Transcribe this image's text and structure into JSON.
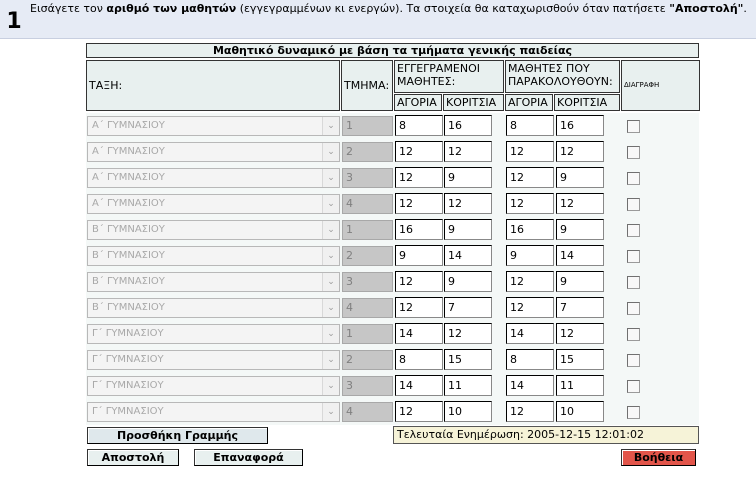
{
  "instruction": {
    "step_number": "1",
    "text_prefix": "Εισάγετε τον ",
    "text_bold1": "αριθμό των μαθητών",
    "text_middle": " (εγγεγραμμένων κι ενεργών). Τα στοιχεία θα καταχωρισθούν όταν πατήσετε ",
    "text_bold2": "\"Αποστολή\"",
    "text_suffix": "."
  },
  "table": {
    "title": "Μαθητικό δυναμικό με βάση τα τμήματα γενικής παιδείας",
    "headers": {
      "class": "ΤΑΞΗ:",
      "section": "ΤΜΗΜΑ:",
      "enrolled": "ΕΓΓΕΓΡΑΜΕΝΟΙ ΜΑΘΗΤΕΣ:",
      "attending": "ΜΑΘΗΤΕΣ ΠΟΥ ΠΑΡΑΚΟΛΟΥΘΟΥΝ:",
      "delete": "ΔΙΑΓΡΑΦΗ",
      "boys": "ΑΓΟΡΙΑ",
      "girls": "ΚΟΡΙΤΣΙΑ"
    },
    "rows": [
      {
        "class": "Α΄ ΓΥΜΝΑΣΙΟΥ",
        "section": "1",
        "enrolled_boys": "8",
        "enrolled_girls": "16",
        "attending_boys": "8",
        "attending_girls": "16"
      },
      {
        "class": "Α΄ ΓΥΜΝΑΣΙΟΥ",
        "section": "2",
        "enrolled_boys": "12",
        "enrolled_girls": "12",
        "attending_boys": "12",
        "attending_girls": "12"
      },
      {
        "class": "Α΄ ΓΥΜΝΑΣΙΟΥ",
        "section": "3",
        "enrolled_boys": "12",
        "enrolled_girls": "9",
        "attending_boys": "12",
        "attending_girls": "9"
      },
      {
        "class": "Α΄ ΓΥΜΝΑΣΙΟΥ",
        "section": "4",
        "enrolled_boys": "12",
        "enrolled_girls": "12",
        "attending_boys": "12",
        "attending_girls": "12"
      },
      {
        "class": "Β΄ ΓΥΜΝΑΣΙΟΥ",
        "section": "1",
        "enrolled_boys": "16",
        "enrolled_girls": "9",
        "attending_boys": "16",
        "attending_girls": "9"
      },
      {
        "class": "Β΄ ΓΥΜΝΑΣΙΟΥ",
        "section": "2",
        "enrolled_boys": "9",
        "enrolled_girls": "14",
        "attending_boys": "9",
        "attending_girls": "14"
      },
      {
        "class": "Β΄ ΓΥΜΝΑΣΙΟΥ",
        "section": "3",
        "enrolled_boys": "12",
        "enrolled_girls": "9",
        "attending_boys": "12",
        "attending_girls": "9"
      },
      {
        "class": "Β΄ ΓΥΜΝΑΣΙΟΥ",
        "section": "4",
        "enrolled_boys": "12",
        "enrolled_girls": "7",
        "attending_boys": "12",
        "attending_girls": "7"
      },
      {
        "class": "Γ΄ ΓΥΜΝΑΣΙΟΥ",
        "section": "1",
        "enrolled_boys": "14",
        "enrolled_girls": "12",
        "attending_boys": "14",
        "attending_girls": "12"
      },
      {
        "class": "Γ΄ ΓΥΜΝΑΣΙΟΥ",
        "section": "2",
        "enrolled_boys": "8",
        "enrolled_girls": "15",
        "attending_boys": "8",
        "attending_girls": "15"
      },
      {
        "class": "Γ΄ ΓΥΜΝΑΣΙΟΥ",
        "section": "3",
        "enrolled_boys": "14",
        "enrolled_girls": "11",
        "attending_boys": "14",
        "attending_girls": "11"
      },
      {
        "class": "Γ΄ ΓΥΜΝΑΣΙΟΥ",
        "section": "4",
        "enrolled_boys": "12",
        "enrolled_girls": "10",
        "attending_boys": "12",
        "attending_girls": "10"
      }
    ]
  },
  "buttons": {
    "add_row": "Προσθήκη Γραμμής",
    "send": "Αποστολή",
    "reset": "Επαναφορά",
    "help": "Βοήθεια"
  },
  "last_updated": "Τελευταία Ενημέρωση: 2005-12-15 12:01:02",
  "colors": {
    "header_bg": "#e8f0ef",
    "instruction_bg": "#e6ebf5",
    "help_button": "#e2554a",
    "updated_bg": "#f6f3d8"
  }
}
